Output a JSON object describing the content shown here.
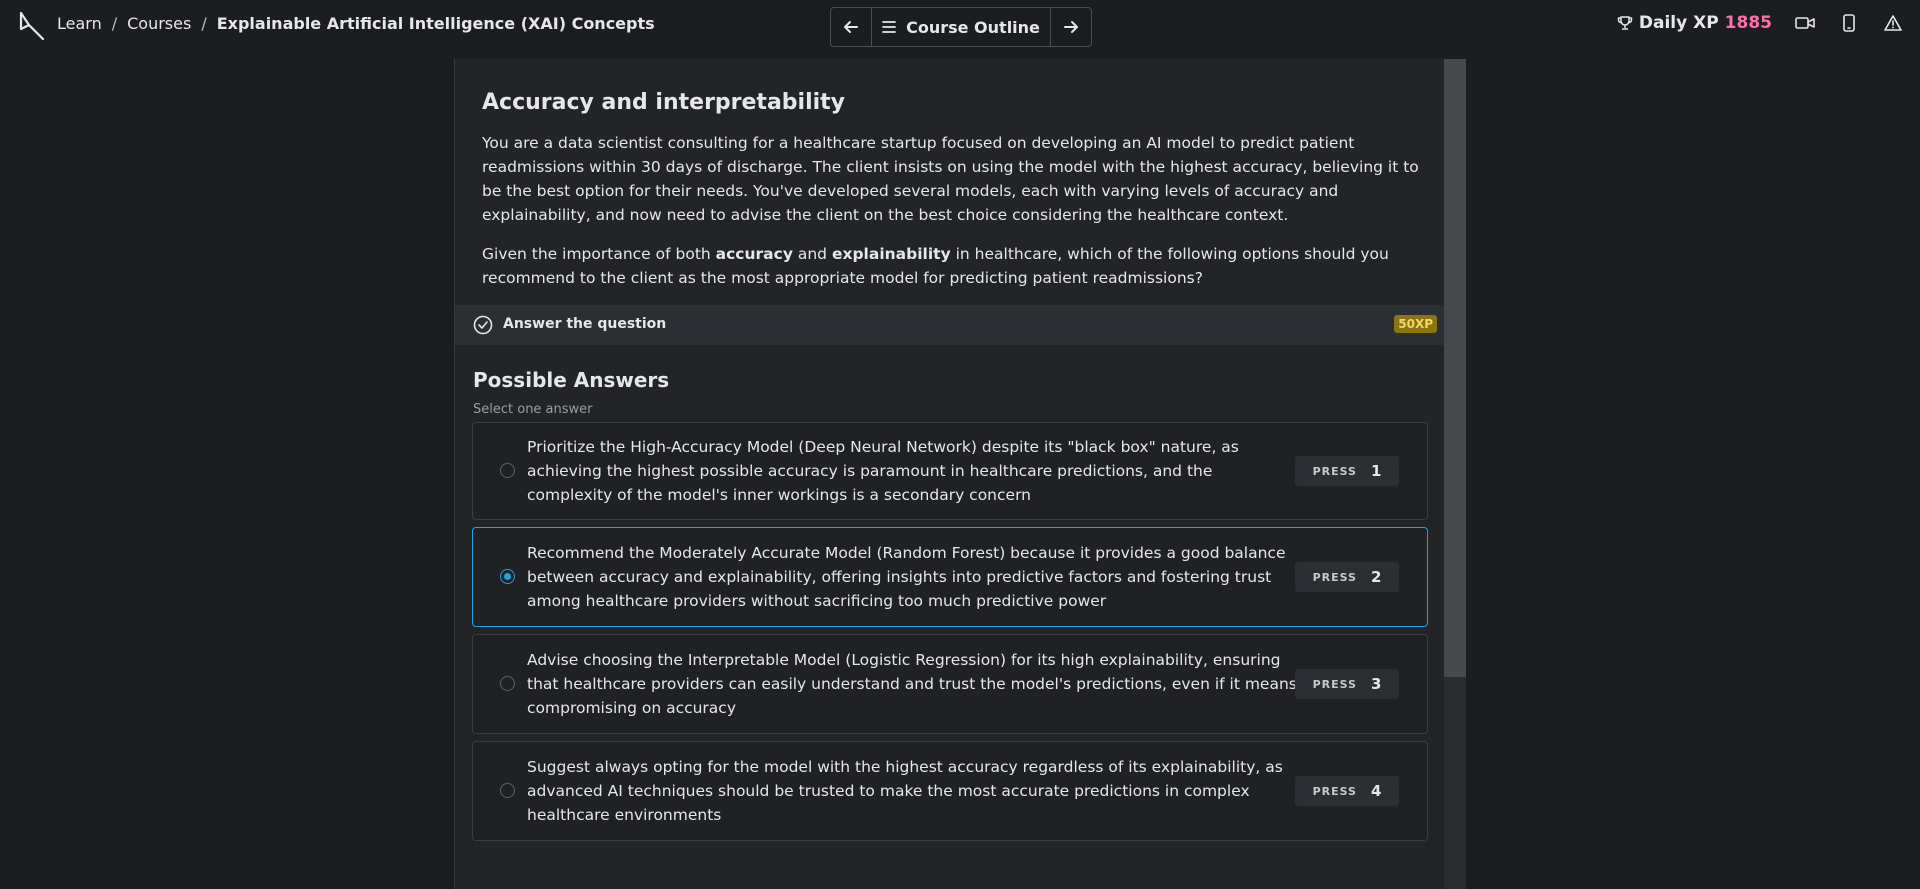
{
  "breadcrumb": {
    "items": [
      "Learn",
      "Courses"
    ],
    "separator": "/",
    "current": "Explainable Artificial Intelligence (XAI) Concepts"
  },
  "nav": {
    "outline_label": "Course Outline"
  },
  "xp": {
    "label": "Daily XP",
    "value": "1885"
  },
  "exercise": {
    "title": "Accuracy and interpretability",
    "context": "You are a data scientist consulting for a healthcare startup focused on developing an AI model to predict patient readmissions within 30 days of discharge. The client insists on using the model with the highest accuracy, believing it to be the best option for their needs. You've developed several models, each with varying levels of accuracy and explainability, and now need to advise the client on the best choice considering the healthcare context.",
    "question_before": "Given the importance of both ",
    "question_bold1": "accuracy",
    "question_mid": " and ",
    "question_bold2": "explainability",
    "question_after": " in healthcare, which of the following options should you recommend to the client as the most appropriate model for predicting patient readmissions?"
  },
  "task": {
    "label": "Answer the question",
    "xp": "50XP"
  },
  "answers": {
    "title": "Possible Answers",
    "subtitle": "Select one answer",
    "press_label": "PRESS",
    "selected_index": 1,
    "options": [
      {
        "text": "Prioritize the High-Accuracy Model (Deep Neural Network) despite its \"black box\" nature, as achieving the highest possible accuracy is paramount in healthcare predictions, and the complexity of the model's inner workings is a secondary concern",
        "key": "1"
      },
      {
        "text": "Recommend the Moderately Accurate Model (Random Forest) because it provides a good balance between accuracy and explainability, offering insights into predictive factors and fostering trust among healthcare providers without sacrificing too much predictive power",
        "key": "2"
      },
      {
        "text": "Advise choosing the Interpretable Model (Logistic Regression) for its high explainability, ensuring that healthcare providers can easily understand and trust the model's predictions, even if it means compromising on accuracy",
        "key": "3"
      },
      {
        "text": "Suggest always opting for the model with the highest accuracy regardless of its explainability, as advanced AI techniques should be trusted to make the most accurate predictions in complex healthcare environments",
        "key": "4"
      }
    ]
  },
  "colors": {
    "accent": "#1ba3e6",
    "xp_number": "#ff6ea9",
    "xp_badge": "#8a7510"
  },
  "icons": [
    "logo-icon",
    "arrow-left-icon",
    "menu-icon",
    "arrow-right-icon",
    "trophy-icon",
    "video-icon",
    "mobile-icon",
    "alert-icon",
    "check-circle-icon"
  ]
}
